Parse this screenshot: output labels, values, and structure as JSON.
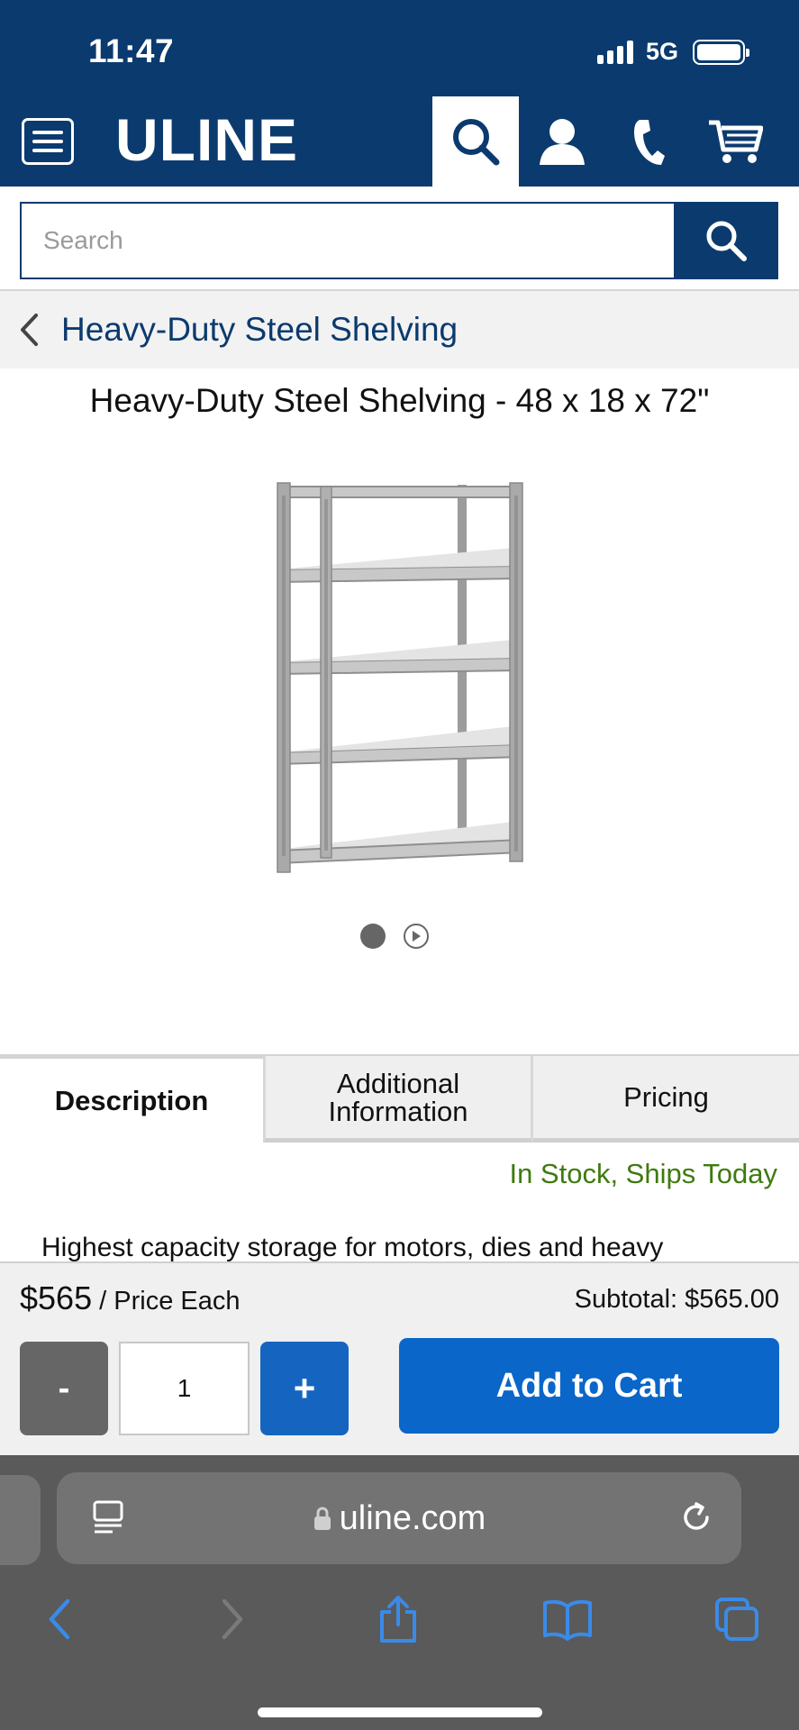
{
  "status_bar": {
    "time": "11:47",
    "network": "5G"
  },
  "header": {
    "logo": "ULINE"
  },
  "search": {
    "placeholder": "Search"
  },
  "breadcrumb": {
    "label": "Heavy-Duty Steel Shelving"
  },
  "product": {
    "title": "Heavy-Duty Steel Shelving - 48 x 18 x 72\"",
    "image_slides": 2,
    "active_slide": 1
  },
  "tabs": [
    {
      "label": "Description",
      "active": true
    },
    {
      "label": "Additional Information",
      "active": false
    },
    {
      "label": "Pricing",
      "active": false
    }
  ],
  "stock_status": "In Stock, Ships Today",
  "description_preview": "Highest capacity storage for motors, dies and heavy",
  "cart": {
    "price": "$565",
    "price_suffix": " / Price Each",
    "subtotal": "Subtotal: $565.00",
    "minus_label": "-",
    "quantity": "1",
    "plus_label": "+",
    "add_label": "Add to Cart"
  },
  "browser": {
    "url": "uline.com"
  },
  "colors": {
    "brand_navy": "#0b3a6e",
    "cart_blue": "#0a66c8",
    "stock_green": "#3f7a0f",
    "safari_gray": "#5a5a5a"
  },
  "icons": [
    "menu-icon",
    "search-icon",
    "account-icon",
    "phone-icon",
    "cart-icon",
    "chevron-left-icon",
    "play-icon",
    "reader-icon",
    "lock-icon",
    "reload-icon",
    "back-icon",
    "forward-icon",
    "share-icon",
    "bookmarks-icon",
    "tabs-icon"
  ]
}
